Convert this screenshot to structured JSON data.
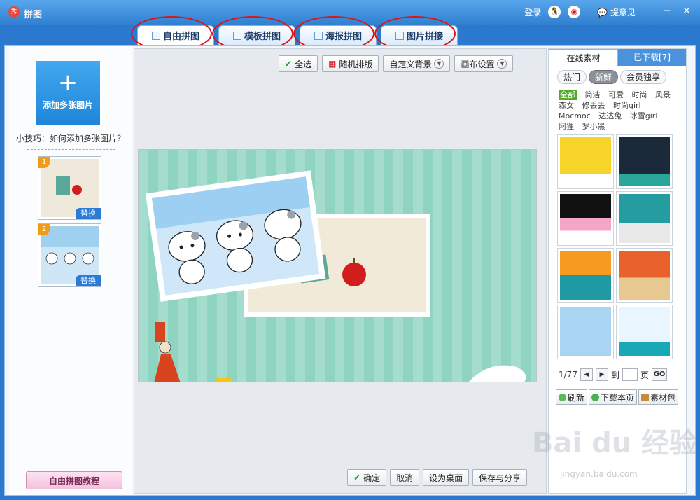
{
  "window": {
    "title": "拼图",
    "login": "登录",
    "feedback": "提意见"
  },
  "tabs": [
    {
      "label": "自由拼图"
    },
    {
      "label": "模板拼图"
    },
    {
      "label": "海报拼图"
    },
    {
      "label": "图片拼接"
    }
  ],
  "left": {
    "add_button": "添加多张图片",
    "tip": "小技巧：如何添加多张图片？",
    "thumbs": [
      {
        "number": "1",
        "replace": "替换"
      },
      {
        "number": "2",
        "replace": "替换"
      }
    ],
    "tutorial": "自由拼图教程"
  },
  "toolbar": {
    "select_all": "全选",
    "random_layout": "随机排版",
    "custom_bg": "自定义背景",
    "canvas_settings": "画布设置"
  },
  "footer": {
    "confirm": "确定",
    "cancel": "取消",
    "set_desktop": "设为桌面",
    "save_share": "保存与分享"
  },
  "right": {
    "tab_online": "在线素材",
    "tab_downloaded": "已下载[7]",
    "filters": [
      "热门",
      "新鲜",
      "会员独享"
    ],
    "active_filter": "新鲜",
    "categories": [
      "全部",
      "简洁",
      "可爱",
      "时尚",
      "风景",
      "森女",
      "修丢丢",
      "时尚girl",
      "Mocmoc",
      "达达兔",
      "冰雪girl",
      "阿狸",
      "罗小黑"
    ],
    "active_category": "全部",
    "pager": {
      "text": "1/77",
      "goto": "到",
      "page": "页",
      "go": "GO"
    },
    "actions": {
      "refresh": "刷新",
      "download_page": "下载本页",
      "material_pack": "素材包"
    }
  },
  "watermark": {
    "brand": "Bai du 经验",
    "url": "jingyan.baidu.com"
  },
  "colors": {
    "title_bar": "#2f7fd0",
    "accent": "#1f85da",
    "highlight_ring": "#d8151a",
    "canvas_bg": "#8fd3c1"
  }
}
